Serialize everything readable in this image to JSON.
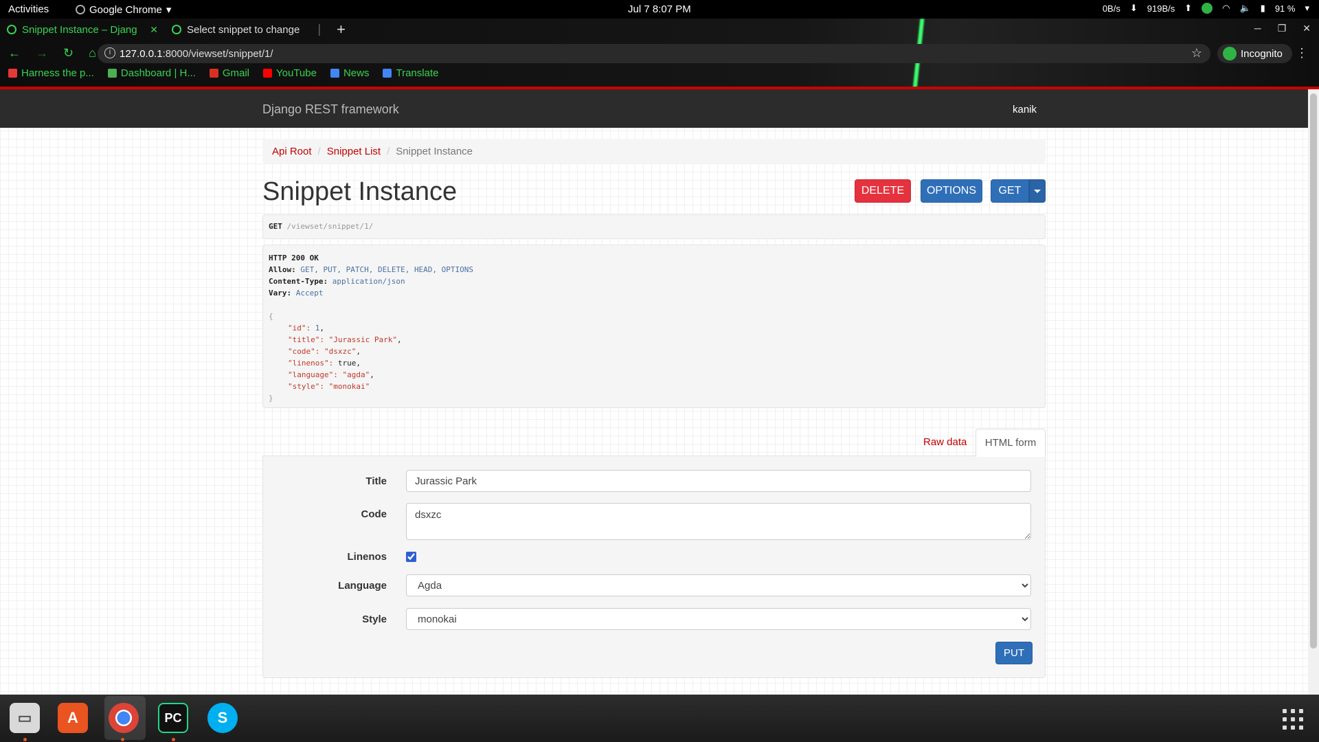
{
  "os": {
    "activities": "Activities",
    "app_menu": "Google Chrome",
    "clock": "Jul 7  8:07 PM",
    "net_down": "0B/s",
    "net_up": "919B/s",
    "battery": "91 %"
  },
  "browser": {
    "tabs": [
      {
        "label": "Snippet Instance – Djang",
        "active": true
      },
      {
        "label": "Select snippet to change",
        "active": false
      }
    ],
    "url_host": "127.0.0.1",
    "url_path": ":8000/viewset/snippet/1/",
    "incognito_label": "Incognito",
    "bookmarks": [
      {
        "label": "Harness the p...",
        "color": "#e53935"
      },
      {
        "label": "Dashboard | H...",
        "color": "#4caf50"
      },
      {
        "label": "Gmail",
        "color": "#d93025"
      },
      {
        "label": "YouTube",
        "color": "#ff0000"
      },
      {
        "label": "News",
        "color": "#4285f4"
      },
      {
        "label": "Translate",
        "color": "#4285f4"
      }
    ]
  },
  "drf": {
    "brand": "Django REST framework",
    "user": "kanik",
    "breadcrumb": {
      "root": "Api Root",
      "list": "Snippet List",
      "current": "Snippet Instance"
    },
    "title": "Snippet Instance",
    "buttons": {
      "delete": "DELETE",
      "options": "OPTIONS",
      "get": "GET",
      "put": "PUT"
    },
    "request": {
      "method": "GET",
      "path": "/viewset/snippet/1/"
    },
    "response": {
      "status": "HTTP 200 OK",
      "allow_key": "Allow:",
      "allow_val": "GET, PUT, PATCH, DELETE, HEAD, OPTIONS",
      "ctype_key": "Content-Type:",
      "ctype_val": "application/json",
      "vary_key": "Vary:",
      "vary_val": "Accept",
      "open_brace": "{",
      "close_brace": "}",
      "json_lines": [
        {
          "key": "\"id\": ",
          "val": "1",
          "type": "n",
          "comma": ","
        },
        {
          "key": "\"title\": ",
          "val": "\"Jurassic Park\"",
          "type": "s",
          "comma": ","
        },
        {
          "key": "\"code\": ",
          "val": "\"dsxzc\"",
          "type": "s",
          "comma": ","
        },
        {
          "key": "\"linenos\": ",
          "val": "true",
          "type": "n",
          "comma": ","
        },
        {
          "key": "\"language\": ",
          "val": "\"agda\"",
          "type": "s",
          "comma": ","
        },
        {
          "key": "\"style\": ",
          "val": "\"monokai\"",
          "type": "s",
          "comma": ""
        }
      ]
    },
    "form_tabs": {
      "raw": "Raw data",
      "html": "HTML form"
    },
    "form": {
      "title_label": "Title",
      "title_value": "Jurassic Park",
      "code_label": "Code",
      "code_value": "dsxzc",
      "linenos_label": "Linenos",
      "linenos_checked": true,
      "language_label": "Language",
      "language_value": "Agda",
      "style_label": "Style",
      "style_value": "monokai"
    }
  },
  "colors": {
    "accent_red": "#c20000",
    "primary_blue": "#2f6fb8",
    "danger": "#e5323e"
  }
}
